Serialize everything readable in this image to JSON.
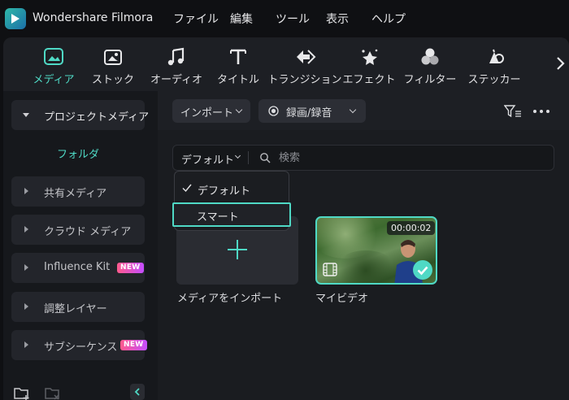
{
  "app": {
    "name": "Wondershare Filmora"
  },
  "menu": [
    "ファイル",
    "編集",
    "ツール",
    "表示",
    "ヘルプ"
  ],
  "toolbar": {
    "items": [
      {
        "label": "メディア",
        "icon": "media-icon",
        "active": true
      },
      {
        "label": "ストック",
        "icon": "stock-icon",
        "active": false
      },
      {
        "label": "オーディオ",
        "icon": "music-note-icon",
        "active": false
      },
      {
        "label": "タイトル",
        "icon": "title-text-icon",
        "active": false
      },
      {
        "label": "トランジション",
        "icon": "transition-icon",
        "active": false
      },
      {
        "label": "エフェクト",
        "icon": "effects-sparkle-icon",
        "active": false
      },
      {
        "label": "フィルター",
        "icon": "filter-circles-icon",
        "active": false
      },
      {
        "label": "ステッカー",
        "icon": "sticker-icon",
        "active": false
      }
    ],
    "next_icon": "chevron-right-icon"
  },
  "sidebar": {
    "project_media": "プロジェクトメディア",
    "folder": "フォルダ",
    "items": [
      {
        "label": "共有メディア",
        "badge": ""
      },
      {
        "label": "クラウド メディア",
        "badge": ""
      },
      {
        "label": "Influence Kit",
        "badge": "NEW"
      },
      {
        "label": "調整レイヤー",
        "badge": ""
      },
      {
        "label": "サブシーケンス",
        "badge": "NEW"
      }
    ]
  },
  "main": {
    "import_button": "インポート",
    "record_button": "録画/録音",
    "sort_label": "デフォルト",
    "search_placeholder": "検索",
    "dropdown": {
      "options": [
        "デフォルト",
        "スマート"
      ],
      "selected": "デフォルト",
      "highlighted": "スマート"
    },
    "cards": [
      {
        "caption": "メディアをインポート"
      },
      {
        "caption": "マイビデオ",
        "duration": "00:00:02"
      }
    ]
  },
  "colors": {
    "accent": "#4fd9c5",
    "background": "#0f1013",
    "panel": "#1d1f24",
    "badge_gradient_start": "#ff5a8c",
    "badge_gradient_end": "#c44dff"
  }
}
